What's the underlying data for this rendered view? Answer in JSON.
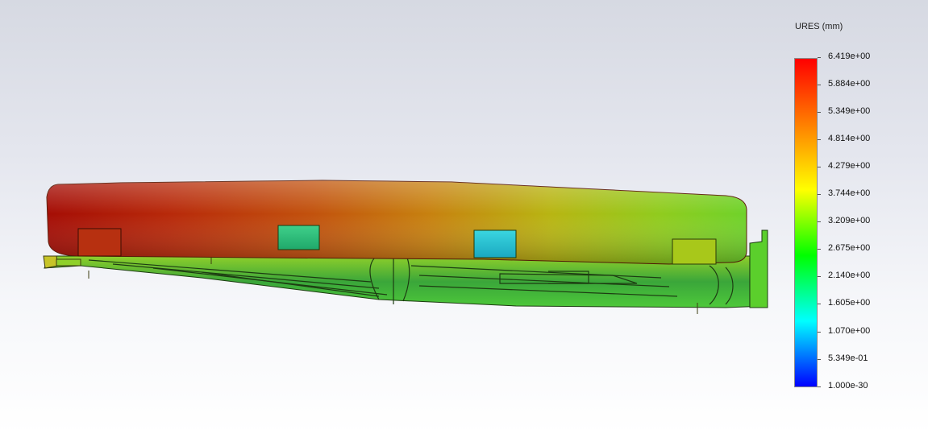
{
  "legend": {
    "title": "URES (mm)",
    "labels": [
      "6.419e+00",
      "5.884e+00",
      "5.349e+00",
      "4.814e+00",
      "4.279e+00",
      "3.744e+00",
      "3.209e+00",
      "2.675e+00",
      "2.140e+00",
      "1.605e+00",
      "1.070e+00",
      "5.349e-01",
      "1.000e-30"
    ],
    "colors": [
      "#ff0000",
      "#ff7f00",
      "#ffff00",
      "#00ff00",
      "#00ffff",
      "#0000ff"
    ]
  }
}
